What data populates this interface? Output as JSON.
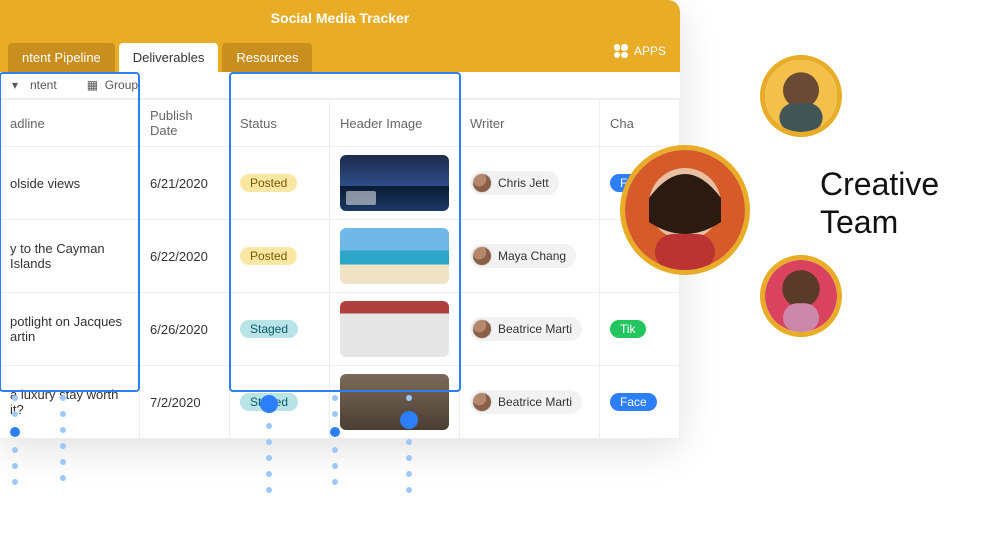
{
  "title": "Social Media Tracker",
  "tabs": [
    {
      "label": "ntent Pipeline",
      "active": false
    },
    {
      "label": "Deliverables",
      "active": true
    },
    {
      "label": "Resources",
      "active": false
    }
  ],
  "apps_label": "APPS",
  "toolbar": {
    "item1": "ntent",
    "item2": "Group"
  },
  "columns": {
    "headline": "adline",
    "publish": "Publish Date",
    "status": "Status",
    "header_img": "Header Image",
    "writer": "Writer",
    "channel": "Cha"
  },
  "rows": [
    {
      "headline": "olside views",
      "date": "6/21/2020",
      "status": "Posted",
      "status_kind": "posted",
      "writer": "Chris Jett",
      "channel": "Face",
      "channel_kind": "blue",
      "thumb": "th1"
    },
    {
      "headline": "y to the Cayman Islands",
      "date": "6/22/2020",
      "status": "Posted",
      "status_kind": "posted",
      "writer": "Maya Chang",
      "channel": "",
      "channel_kind": "",
      "thumb": "th2"
    },
    {
      "headline": "potlight on Jacques artin",
      "date": "6/26/2020",
      "status": "Staged",
      "status_kind": "staged",
      "writer": "Beatrice Marti",
      "channel": "Tik",
      "channel_kind": "green",
      "thumb": "th3"
    },
    {
      "headline": "a luxury stay worth it?",
      "date": "7/2/2020",
      "status": "Staged",
      "status_kind": "staged",
      "writer": "Beatrice Marti",
      "channel": "Face",
      "channel_kind": "blue",
      "thumb": "th4"
    }
  ],
  "team_label_line1": "Creative",
  "team_label_line2": "Team",
  "colors": {
    "brand": "#e8ac26",
    "selection": "#2d7ff9"
  }
}
